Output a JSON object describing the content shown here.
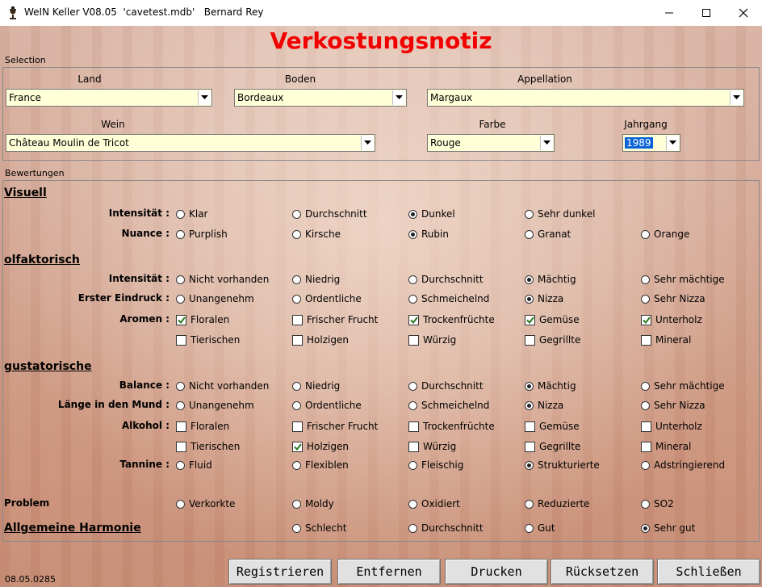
{
  "window": {
    "title": "WeIN Keller V08.05  'cavetest.mdb'   Bernard Rey",
    "controls": [
      "minimize-icon",
      "maximize-icon",
      "close-icon"
    ]
  },
  "heading": "Verkostungsnotiz",
  "selection": {
    "label": "Selection",
    "land": {
      "label": "Land",
      "value": "France"
    },
    "boden": {
      "label": "Boden",
      "value": "Bordeaux"
    },
    "appellation": {
      "label": "Appellation",
      "value": "Margaux"
    },
    "wein": {
      "label": "Wein",
      "value": "Château Moulin de Tricot"
    },
    "farbe": {
      "label": "Farbe",
      "value": "Rouge"
    },
    "jahrgang": {
      "label": "Jahrgang",
      "value": "1989"
    }
  },
  "bewertungen": {
    "label": "Bewertungen",
    "visuell": {
      "title": "Visuell",
      "intensitaet": {
        "label": "Intensität :",
        "options": [
          "Klar",
          "Durchschnitt",
          "Dunkel",
          "Sehr dunkel"
        ],
        "selected": 2
      },
      "nuance": {
        "label": "Nuance :",
        "options": [
          "Purplish",
          "Kirsche",
          "Rubin",
          "Granat",
          "Orange"
        ],
        "selected": 2
      }
    },
    "olfaktorisch": {
      "title": "olfaktorisch",
      "intensitaet": {
        "label": "Intensität :",
        "options": [
          "Nicht vorhanden",
          "Niedrig",
          "Durchschnitt",
          "Mächtig",
          "Sehr mächtige"
        ],
        "selected": 3
      },
      "erster": {
        "label": "Erster Eindruck :",
        "options": [
          "Unangenehm",
          "Ordentliche",
          "Schmeichelnd",
          "Nizza",
          "Sehr Nizza"
        ],
        "selected": 3
      },
      "aromen": {
        "label": "Aromen :",
        "row1": [
          "Floralen",
          "Frischer Frucht",
          "Trockenfrüchte",
          "Gemüse",
          "Unterholz"
        ],
        "row1_checked": [
          true,
          false,
          true,
          true,
          true
        ],
        "row2": [
          "Tierischen",
          "Holzigen",
          "Würzig",
          "Gegrillte",
          "Mineral"
        ],
        "row2_checked": [
          false,
          false,
          false,
          false,
          false
        ]
      }
    },
    "gustatorische": {
      "title": "gustatorische",
      "balance": {
        "label": "Balance :",
        "options": [
          "Nicht vorhanden",
          "Niedrig",
          "Durchschnitt",
          "Mächtig",
          "Sehr mächtige"
        ],
        "selected": 3
      },
      "laenge": {
        "label": "Länge in den Mund :",
        "options": [
          "Unangenehm",
          "Ordentliche",
          "Schmeichelnd",
          "Nizza",
          "Sehr Nizza"
        ],
        "selected": 3
      },
      "alkohol": {
        "label": "Alkohol :",
        "row1": [
          "Floralen",
          "Frischer Frucht",
          "Trockenfrüchte",
          "Gemüse",
          "Unterholz"
        ],
        "row1_checked": [
          false,
          false,
          false,
          false,
          false
        ],
        "row2": [
          "Tierischen",
          "Holzigen",
          "Würzig",
          "Gegrillte",
          "Mineral"
        ],
        "row2_checked": [
          false,
          true,
          false,
          false,
          false
        ]
      },
      "tannine": {
        "label": "Tannine :",
        "options": [
          "Fluid",
          "Flexiblen",
          "Fleischig",
          "Strukturierte",
          "Adstringierend"
        ],
        "selected": 3
      }
    },
    "problem": {
      "title": "Problem",
      "options": [
        "Verkorkte",
        "Moldy",
        "Oxidiert",
        "Reduzierte",
        "SO2"
      ],
      "selected": -1
    },
    "harmonie": {
      "title": "Allgemeine Harmonie",
      "options": [
        "Schlecht",
        "Durchschnitt",
        "Gut",
        "Sehr gut"
      ],
      "selected": 3
    }
  },
  "buttons": {
    "registrieren": "Registrieren",
    "entfernen": "Entfernen",
    "drucken": "Drucken",
    "ruecksetzen": "Rücksetzen",
    "schliessen": "Schließen"
  },
  "version": "08.05.0285",
  "colors": {
    "heading": "#f20000",
    "combo_bg": "#ffffd8",
    "selection_highlight": "#0a64d8"
  }
}
